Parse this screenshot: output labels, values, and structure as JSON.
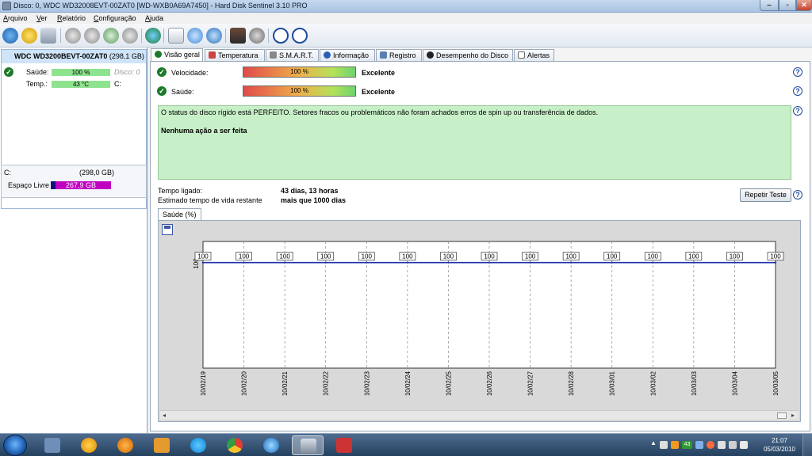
{
  "window": {
    "title": "Disco: 0, WDC WD32008EVT-00ZAT0 [WD-WXB0A69A7450]  -  Hard Disk Sentinel 3.10 PRO",
    "min_symbol": "‒",
    "max_symbol": "▫",
    "close_symbol": "✕"
  },
  "menu": [
    "Arquivo",
    "Ver",
    "Relatório",
    "Configuração",
    "Ajuda"
  ],
  "disk": {
    "name": "WDC WD3200BEVT-00ZAT0",
    "size": "(298,1 GB)",
    "health_label": "Saúde:",
    "health_value": "100 %",
    "health_fraction": 1.0,
    "disk_index": "Disco: 0",
    "temp_label": "Temp.:",
    "temp_value": "43 °C",
    "drive_letter": "C:"
  },
  "volume": {
    "letter": "C:",
    "size": "(298,0 GB)",
    "free_label": "Espaço Livre",
    "free_value": "267,9 GB"
  },
  "tabs": [
    {
      "label": "Visão geral",
      "icon": "check-icon",
      "active": true
    },
    {
      "label": "Temperatura",
      "icon": "thermometer-icon"
    },
    {
      "label": "S.M.A.R.T.",
      "icon": "disk-icon"
    },
    {
      "label": "Informação",
      "icon": "info-icon"
    },
    {
      "label": "Registro",
      "icon": "log-icon"
    },
    {
      "label": "Desempenho do Disco",
      "icon": "performance-icon"
    },
    {
      "label": "Alertas",
      "icon": "alert-icon"
    }
  ],
  "overview": {
    "speed_label": "Velocidade:",
    "speed_value": "100 %",
    "speed_rating": "Excelente",
    "health_label": "Saúde:",
    "health_value": "100 %",
    "health_rating": "Excelente",
    "status_text": "O status do disco rígido está PERFEITO. Setores fracos ou problemáticos não foram achados erros de spin up ou transferência de dados.",
    "action_text": "Nenhuma ação a ser feita",
    "uptime_label": "Tempo ligado:",
    "uptime_value": "43 dias, 13 horas",
    "lifetime_label": "Estimado tempo de vida restante",
    "lifetime_value": "mais que 1000 dias",
    "repeat_button": "Repetir Teste",
    "help_symbol": "?"
  },
  "graph_tab": "Saúde (%)",
  "chart_data": {
    "type": "line",
    "x": [
      "10/02/19",
      "10/02/20",
      "10/02/21",
      "10/02/22",
      "10/02/23",
      "10/02/24",
      "10/02/25",
      "10/02/26",
      "10/02/27",
      "10/02/28",
      "10/03/01",
      "10/03/02",
      "10/03/03",
      "10/03/04",
      "10/03/05"
    ],
    "series": [
      {
        "values": [
          100,
          100,
          100,
          100,
          100,
          100,
          100,
          100,
          100,
          100,
          100,
          100,
          100,
          100,
          100
        ],
        "color": "#1c2ea8"
      }
    ],
    "y_tick_labels": [
      "100"
    ],
    "grid": true
  },
  "scroll": {
    "left_arrow": "◂",
    "right_arrow": "▸"
  },
  "taskbar": {
    "clock_time": "21:07",
    "clock_date": "05/03/2010",
    "tray_badge": "43"
  },
  "colors": {
    "accent": "#1c2ea8",
    "status_bg": "#c8f0c8",
    "free_space": "#c000c0",
    "health_good": "#8ee38e"
  }
}
